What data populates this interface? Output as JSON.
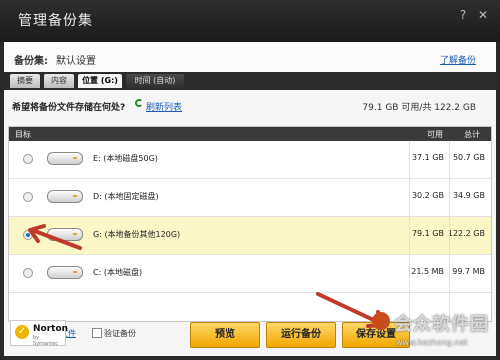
{
  "window": {
    "title": "管理备份集",
    "help": "?",
    "close": "✕"
  },
  "set": {
    "label": "备份集:",
    "value": "默认设置",
    "manage_link": "了解备份"
  },
  "tabs": [
    {
      "label": "摘要"
    },
    {
      "label": "内容"
    },
    {
      "label": "位置 (G:)"
    },
    {
      "label": "时间 (自动)"
    }
  ],
  "location": {
    "question": "希望将备份文件存储在何处?",
    "refresh_link": "刷新列表",
    "capacity": "79.1 GB 可用/共 122.2 GB"
  },
  "table": {
    "headers": {
      "target": "目标",
      "available": "可用",
      "total": "总计"
    },
    "rows": [
      {
        "name": "E: (本地磁盘50G)",
        "available": "37.1 GB",
        "total": "50.7 GB",
        "selected": false
      },
      {
        "name": "D: (本地固定磁盘)",
        "available": "30.2 GB",
        "total": "34.9 GB",
        "selected": false
      },
      {
        "name": "G: (本地备份其他120G)",
        "available": "79.1 GB",
        "total": "122.2 GB",
        "selected": true
      },
      {
        "name": "C: (本地磁盘)",
        "available": "21.5 MB",
        "total": "99.7 MB",
        "selected": false
      }
    ]
  },
  "footer": {
    "delete_link": "删除备份的文件",
    "verify_label": "验证备份"
  },
  "brand": {
    "name": "Norton",
    "sub": "by Symantec"
  },
  "buttons": {
    "preview": "预览",
    "run": "运行备份",
    "save": "保存设置"
  },
  "watermark": {
    "text": "会众软件园",
    "url": "www.hezhong.net"
  },
  "colors": {
    "accent": "#f0a800",
    "link": "#1a5fb4",
    "arrow": "#c0392b"
  }
}
